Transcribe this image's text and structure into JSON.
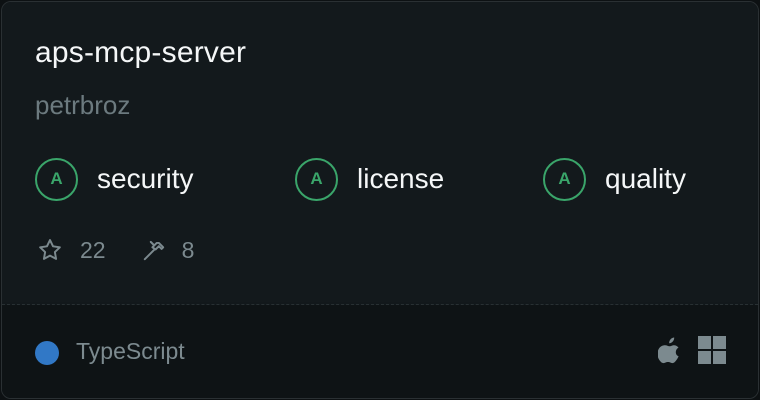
{
  "repo": {
    "name": "aps-mcp-server",
    "owner": "petrbroz"
  },
  "grades": [
    {
      "grade": "A",
      "label": "security"
    },
    {
      "grade": "A",
      "label": "license"
    },
    {
      "grade": "A",
      "label": "quality"
    }
  ],
  "stats": {
    "stars": "22",
    "tools": "8"
  },
  "language": {
    "name": "TypeScript",
    "color": "#3178c6"
  },
  "platforms": [
    "apple-icon",
    "windows-icon"
  ],
  "colors": {
    "grade": "#3aa56a"
  }
}
